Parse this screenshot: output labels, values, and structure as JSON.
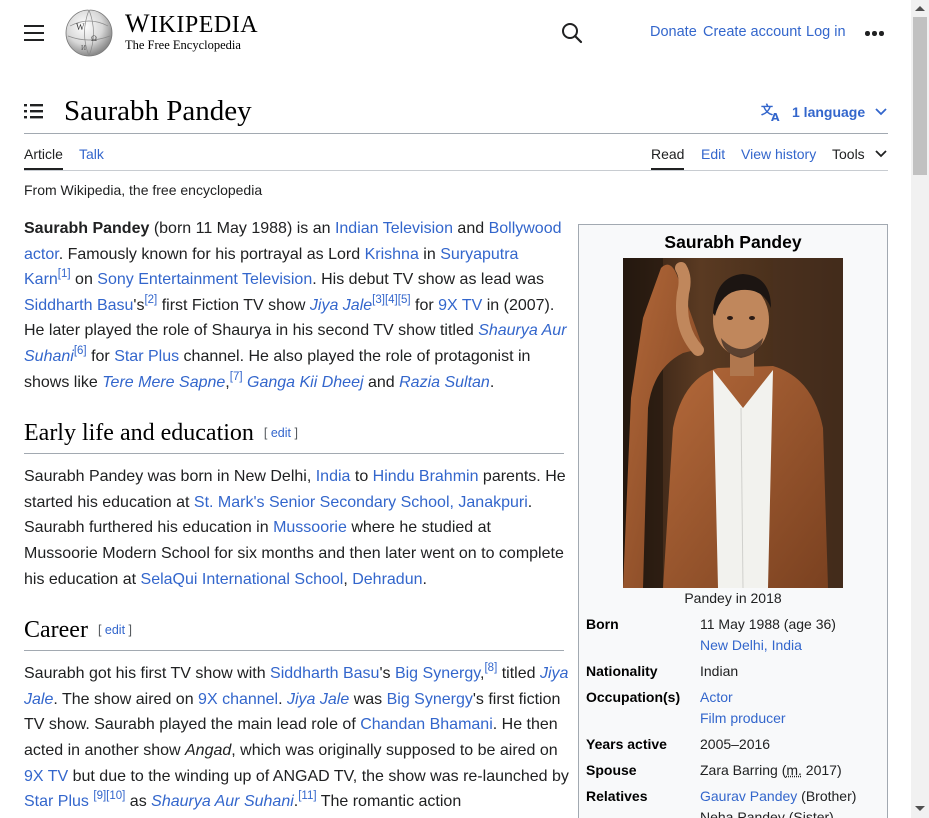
{
  "header": {
    "wordmark_big": "W",
    "wordmark_rest": "IKIPEDIA",
    "tagline": "The Free Encyclopedia",
    "links": {
      "donate": "Donate",
      "create_account": "Create account",
      "log_in": "Log in"
    }
  },
  "page": {
    "title": "Saurabh Pandey",
    "language_button": "1 language",
    "tabs": {
      "article": "Article",
      "talk": "Talk",
      "read": "Read",
      "edit": "Edit",
      "view_history": "View history",
      "tools": "Tools"
    },
    "from_wikipedia": "From Wikipedia, the free encyclopedia"
  },
  "intro": {
    "t0_bold": "Saurabh Pandey",
    "t1": " (born 11 May 1988) is an ",
    "l_indian_tv": "Indian Television",
    "t2": " and ",
    "l_bollywood_actor": "Bollywood actor",
    "t3": ". Famously known for his portrayal as Lord ",
    "l_krishna": "Krishna",
    "t4": " in ",
    "l_suryaputra": "Suryaputra Karn",
    "ref1": "[1]",
    "t5": " on ",
    "l_sony": "Sony Entertainment Television",
    "t6": ". His debut TV show as lead was ",
    "l_siddharth": "Siddharth Basu",
    "t7": "'s",
    "ref2": "[2]",
    "t8": " first Fiction TV show ",
    "l_jiya_jale": "Jiya Jale",
    "ref3": "[3]",
    "ref4": "[4]",
    "ref5": "[5]",
    "t9": " for ",
    "l_9x_tv": "9X TV",
    "t10": " in (2007). He later played the role of Shaurya in his second TV show titled ",
    "l_shaurya": "Shaurya Aur Suhani",
    "ref6": "[6]",
    "t11": " for ",
    "l_star_plus": "Star Plus",
    "t12": " channel. He also played the role of protagonist in shows like ",
    "l_tere_mere": "Tere Mere Sapne",
    "t13": ",",
    "ref7": "[7]",
    "t14": " ",
    "l_ganga": "Ganga Kii Dheej",
    "t15": " and ",
    "l_razia": "Razia Sultan",
    "t16": "."
  },
  "early_life": {
    "heading": "Early life and education",
    "edit_open": "[ ",
    "edit_label": "edit",
    "edit_close": " ]",
    "t1": "Saurabh Pandey was born in New Delhi, ",
    "l_india": "India",
    "t2": " to ",
    "l_hindu_brahmin": "Hindu Brahmin",
    "t3": " parents. He started his education at ",
    "l_st_marks": "St. Mark's Senior Secondary School, Janakpuri",
    "t4": ". Saurabh furthered his education in ",
    "l_mussoorie": "Mussoorie",
    "t5": " where he studied at Mussoorie Modern School for six months and then later went on to complete his education at ",
    "l_selaqui": "SelaQui International School",
    "t6": ", ",
    "l_dehradun": "Dehradun",
    "t7": "."
  },
  "career": {
    "heading": "Career",
    "edit_open": "[ ",
    "edit_label": "edit",
    "edit_close": " ]",
    "t1": "Saurabh got his first TV show with ",
    "l_siddharth": "Siddharth Basu",
    "t2": "'s ",
    "l_big_synergy": "Big Synergy",
    "t3": ",",
    "ref8": "[8]",
    "t4": " titled ",
    "l_jiya_jale": "Jiya Jale",
    "t5": ". The show aired on ",
    "l_9x_channel": "9X channel",
    "t6": ". ",
    "l_jiya_jale2": "Jiya Jale",
    "t7": " was ",
    "l_big_synergy2": "Big Synergy",
    "t8": "'s first fiction TV show. Saurabh played the main lead role of ",
    "l_chandan": "Chandan Bhamani",
    "t9": ". He then acted in another show ",
    "i_angad": "Angad",
    "t10": ", which was originally supposed to be aired on ",
    "l_9x_tv": "9X TV",
    "t11": " but due to the winding up of ANGAD TV, the show was re-launched by ",
    "l_star_plus": "Star Plus",
    "t12": " ",
    "ref9": "[9]",
    "ref10": "[10]",
    "t13": " as ",
    "l_shaurya": "Shaurya Aur Suhani",
    "t14": ".",
    "ref11": "[11]",
    "t15": " The romantic action"
  },
  "infobox": {
    "title": "Saurabh Pandey",
    "caption": "Pandey in 2018",
    "born_label": "Born",
    "born_date": "11 May 1988 (age 36)",
    "born_place": "New Delhi, India",
    "nationality_label": "Nationality",
    "nationality": "Indian",
    "occupation_label": "Occupation(s)",
    "occupation_1": "Actor",
    "occupation_2": "Film producer",
    "years_active_label": "Years active",
    "years_active": "2005–2016",
    "spouse_label": "Spouse",
    "spouse_name": "Zara Barring (",
    "spouse_m": "m.",
    "spouse_year": " 2017)",
    "relatives_label": "Relatives",
    "relative_1": "Gaurav Pandey",
    "relative_1_note": " (Brother)",
    "relative_2": "Neha Pandey (Sister)"
  },
  "colors": {
    "link": "#3366cc",
    "text": "#202122",
    "infobox_bg": "#f8f9fa",
    "border": "#a2a9b1"
  },
  "icons": [
    "hamburger-icon",
    "wikipedia-globe-logo",
    "search-icon",
    "more-icon",
    "toc-icon",
    "translate-icon",
    "chevron-down-icon"
  ]
}
